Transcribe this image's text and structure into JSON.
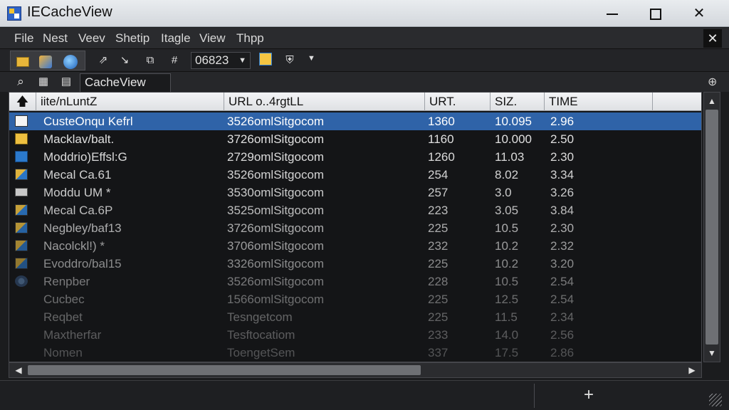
{
  "window": {
    "title": "IECacheView"
  },
  "menu": {
    "items": [
      "File",
      "Nest",
      "Veev",
      "Shetip",
      "Itagle",
      "View",
      "Thpp"
    ]
  },
  "toolbar": {
    "zoom_value": "06823"
  },
  "addressbar": {
    "tab_label": "CacheView"
  },
  "table": {
    "columns": [
      "iite/nLuntZ",
      "URL o..4rgtLL",
      "URT.",
      "SIZ.",
      "TIME"
    ],
    "rows": [
      {
        "name": "CusteOnqu Kefrl",
        "url": "3526omlSitgocom",
        "urt": "1360",
        "size": "10.095",
        "time": "2.96",
        "icon": "page-icon",
        "selected": true
      },
      {
        "name": "Macklav/balt.",
        "url": "3726omlSitgocom",
        "urt": "1160",
        "size": "10.000",
        "time": "2.50",
        "icon": "note-icon",
        "selected": false
      },
      {
        "name": "Moddrio)Effsl:G",
        "url": "2729omlSitgocom",
        "urt": "1260",
        "size": "11.03",
        "time": "2.30",
        "icon": "folder-icon",
        "selected": false
      },
      {
        "name": "Mecal Ca.61",
        "url": "3526omlSitgocom",
        "urt": "254",
        "size": "8.02",
        "time": "3.34",
        "icon": "image-icon",
        "selected": false
      },
      {
        "name": "Moddu UM *",
        "url": "3530omlSitgocom",
        "urt": "257",
        "size": "3.0",
        "time": "3.26",
        "icon": "blank-icon",
        "selected": false
      },
      {
        "name": "Mecal Ca.6P",
        "url": "3525omlSitgocom",
        "urt": "223",
        "size": "3.05",
        "time": "3.84",
        "icon": "image-icon",
        "selected": false
      },
      {
        "name": "Negbley/baf13",
        "url": "3726omlSitgocom",
        "urt": "225",
        "size": "10.5",
        "time": "2.30",
        "icon": "image-icon",
        "selected": false
      },
      {
        "name": "Nacolckl!) *",
        "url": "3706omlSitgocom",
        "urt": "232",
        "size": "10.2",
        "time": "2.32",
        "icon": "image-icon",
        "selected": false
      },
      {
        "name": "Evoddro/bal15",
        "url": "3326omlSitgocom",
        "urt": "225",
        "size": "10.2",
        "time": "3.20",
        "icon": "image-icon",
        "selected": false
      },
      {
        "name": "Renpber",
        "url": "3526omlSitgocom",
        "urt": "228",
        "size": "10.5",
        "time": "2.54",
        "icon": "gear-icon",
        "selected": false
      },
      {
        "name": "Cucbec",
        "url": "1566omlSitgocom",
        "urt": "225",
        "size": "12.5",
        "time": "2.54",
        "icon": "",
        "selected": false
      },
      {
        "name": "Reqbet",
        "url": "Tesngetcom",
        "urt": "225",
        "size": "11.5",
        "time": "2.34",
        "icon": "",
        "selected": false
      },
      {
        "name": "Maxtherfar",
        "url": "Tesftocatiom",
        "urt": "233",
        "size": "14.0",
        "time": "2.56",
        "icon": "",
        "selected": false
      },
      {
        "name": "Nomen",
        "url": "ToengetSem",
        "urt": "337",
        "size": "17.5",
        "time": "2.86",
        "icon": "",
        "selected": false
      }
    ]
  },
  "colors": {
    "selection": "#2f63a8",
    "background": "#141517"
  }
}
